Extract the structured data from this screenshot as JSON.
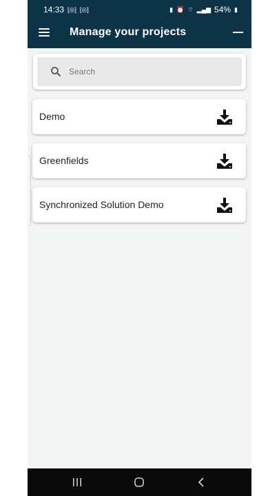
{
  "status_bar": {
    "time": "14:33",
    "battery": "54%"
  },
  "app_bar": {
    "title": "Manage your projects",
    "menu_icon": "hamburger-menu-icon",
    "right_icon": "minimize-icon"
  },
  "search": {
    "placeholder": "Search",
    "value": ""
  },
  "projects": [
    {
      "name": "Demo",
      "icon": "download-icon"
    },
    {
      "name": "Greenfields",
      "icon": "download-icon"
    },
    {
      "name": "Synchronized Solution Demo",
      "icon": "download-icon"
    }
  ],
  "colors": {
    "header": "#0d3347",
    "background": "#f2f5f4",
    "card": "#ffffff",
    "nav_bar": "#0a0a0a"
  }
}
